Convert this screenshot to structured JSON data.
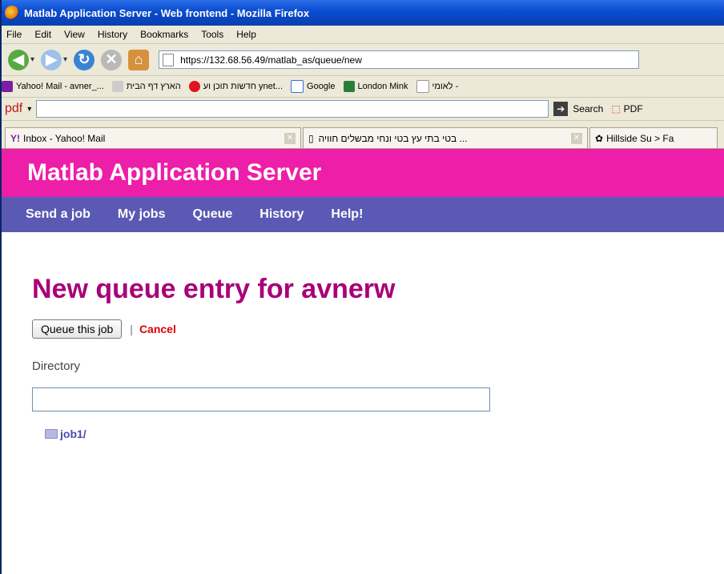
{
  "window": {
    "title": "Matlab Application Server - Web frontend - Mozilla Firefox"
  },
  "menu": [
    "File",
    "Edit",
    "View",
    "History",
    "Bookmarks",
    "Tools",
    "Help"
  ],
  "url": "https://132.68.56.49/matlab_as/queue/new",
  "bookmarks": [
    {
      "label": "Yahoo! Mail - avner_...",
      "icon": "yahoo-icon"
    },
    {
      "label": "הארץ דף הבית",
      "icon": "haaretz-icon"
    },
    {
      "label": "חדשות תוכן וע ynet...",
      "icon": "ynet-icon"
    },
    {
      "label": "Google",
      "icon": "google-icon"
    },
    {
      "label": "London Mink",
      "icon": "london-mink-icon"
    },
    {
      "label": "לאומי -",
      "icon": "page-icon"
    }
  ],
  "pdfbar": {
    "logo": "pdf",
    "search_label": "Search",
    "pdf_label": "PDF"
  },
  "tabs": [
    {
      "label": "Inbox - Yahoo! Mail"
    },
    {
      "label": "בטי בתי עץ בטי ונחי מבשלים חוויה ..."
    },
    {
      "label": "Hillside Su > Fa"
    }
  ],
  "site": {
    "title": "Matlab Application Server",
    "nav": [
      "Send a job",
      "My jobs",
      "Queue",
      "History",
      "Help!"
    ]
  },
  "page": {
    "heading": "New queue entry for avnerw",
    "queue_button": "Queue this job",
    "separator": "|",
    "cancel": "Cancel",
    "directory_label": "Directory",
    "folder": "job1/"
  },
  "colors": {
    "header": "#ed1ea8",
    "nav": "#5a59b3",
    "heading": "#a80079"
  }
}
